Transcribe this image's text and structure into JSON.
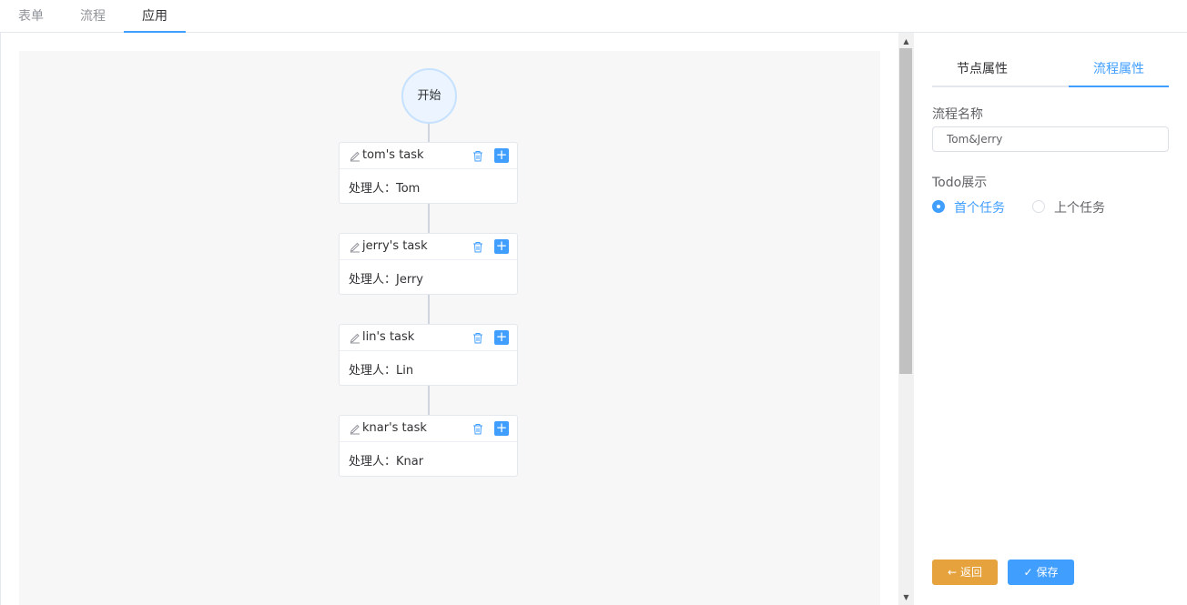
{
  "top_tabs": [
    {
      "label": "表单",
      "active": false
    },
    {
      "label": "流程",
      "active": false
    },
    {
      "label": "应用",
      "active": true
    }
  ],
  "flow": {
    "start_label": "开始",
    "tasks": [
      {
        "title": "tom's task",
        "handler": "处理人：Tom"
      },
      {
        "title": "jerry's task",
        "handler": "处理人：Jerry"
      },
      {
        "title": "lin's task",
        "handler": "处理人：Lin"
      },
      {
        "title": "knar's task",
        "handler": "处理人：Knar"
      }
    ],
    "add_symbol": "+"
  },
  "side_panel": {
    "tabs": [
      {
        "label": "节点属性",
        "active": false
      },
      {
        "label": "流程属性",
        "active": true
      }
    ],
    "flow_name_label": "流程名称",
    "flow_name_value": "Tom&Jerry",
    "todo_label": "Todo展示",
    "todo_options": [
      {
        "label": "首个任务",
        "checked": true
      },
      {
        "label": "上个任务",
        "checked": false
      }
    ],
    "back_button": "返回",
    "save_button": "保存"
  },
  "colors": {
    "accent": "#409eff",
    "warning": "#e6a23c",
    "canvas_bg": "#f7f7f7",
    "start_node_bg": "#ecf5ff"
  },
  "icons": {
    "edit": "edit-icon",
    "delete": "trash-icon",
    "add": "plus-icon",
    "back": "arrow-left-icon",
    "save": "check-icon"
  }
}
